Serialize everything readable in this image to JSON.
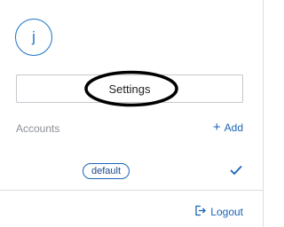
{
  "user": {
    "avatar_initial": "j"
  },
  "menu": {
    "settings_label": "Settings"
  },
  "accounts": {
    "section_label": "Accounts",
    "add_label": "Add",
    "items": [
      {
        "badge": "default",
        "selected": true
      }
    ]
  },
  "footer": {
    "logout_label": "Logout"
  },
  "icons": {
    "add": "plus-icon",
    "selected": "check-icon",
    "logout": "logout-icon"
  },
  "colors": {
    "accent": "#1a63b8",
    "avatar_border": "#1a73c8",
    "muted_text": "#8a8f95",
    "border": "#c4c8cd"
  }
}
